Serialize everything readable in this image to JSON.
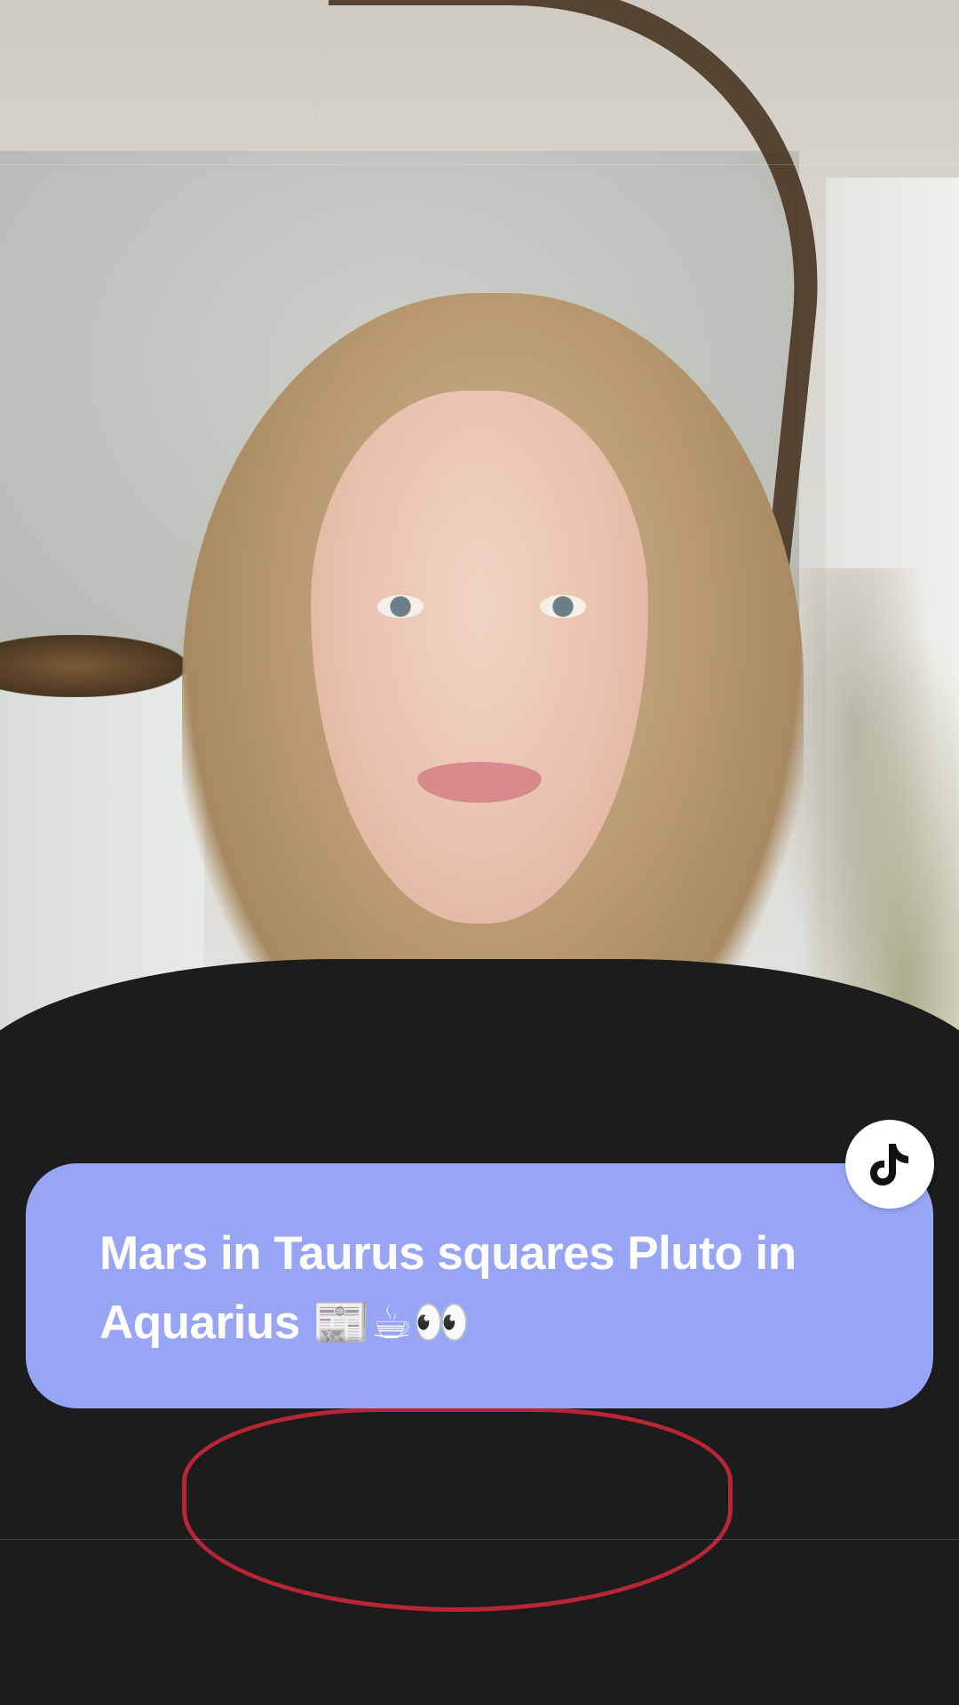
{
  "caption": {
    "text": "Mars in Taurus squares Pluto in Aquarius 📰☕👀"
  },
  "badge": {
    "icon": "tiktok-logo-icon"
  },
  "colors": {
    "caption_bg": "#97a5f4",
    "caption_text": "#ffffff",
    "badge_bg": "#ffffff",
    "badge_icon": "#111111"
  }
}
